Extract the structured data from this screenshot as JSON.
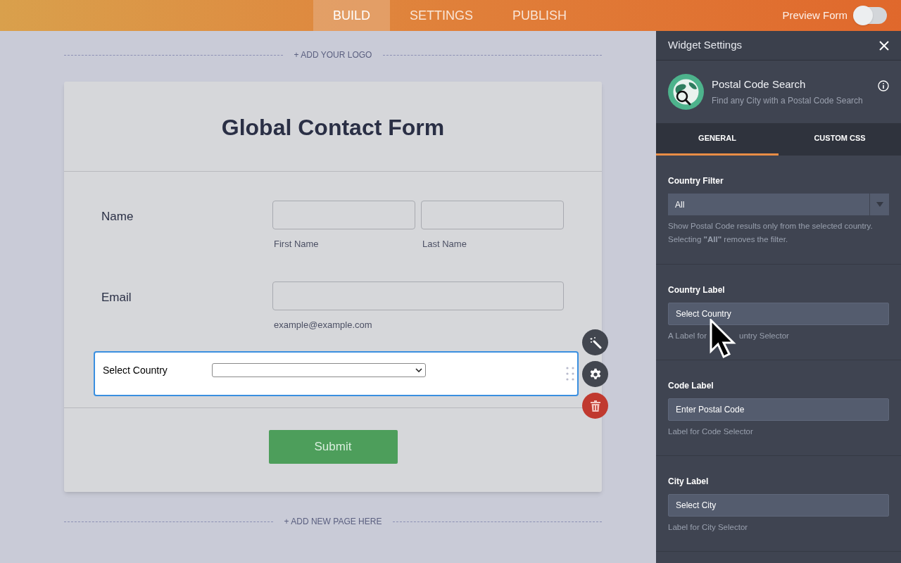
{
  "top_bar": {
    "tabs": [
      {
        "label": "BUILD",
        "selected": true
      },
      {
        "label": "SETTINGS",
        "selected": false
      },
      {
        "label": "PUBLISH",
        "selected": false
      }
    ],
    "preview": {
      "label": "Preview Form",
      "on": false
    }
  },
  "canvas": {
    "add_logo": "+ ADD YOUR LOGO",
    "add_page": "+ ADD NEW PAGE HERE"
  },
  "form": {
    "title": "Global Contact Form",
    "fields": [
      {
        "kind": "name",
        "label": "Name",
        "sublabels": [
          "First Name",
          "Last Name"
        ]
      },
      {
        "kind": "email",
        "label": "Email",
        "sublabels": [
          "example@example.com"
        ]
      },
      {
        "kind": "select",
        "label": "Select Country",
        "selected": true
      }
    ],
    "submit": "Submit"
  },
  "widget_settings": {
    "title": "Widget Settings",
    "widget_name": "Postal Code Search",
    "widget_description": "Find any City with a Postal Code Search",
    "tabs": [
      {
        "label": "GENERAL",
        "selected": true
      },
      {
        "label": "CUSTOM CSS",
        "selected": false
      }
    ],
    "settings": [
      {
        "kind": "dropdown",
        "label": "Country Filter",
        "value": "All",
        "hint": "Show Postal Code results only from the selected country. Selecting **\"All\"** removes the filter."
      },
      {
        "kind": "text",
        "label": "Country Label",
        "value": "Select Country",
        "hint_parts": [
          "A Label for",
          "untry Selector"
        ]
      },
      {
        "kind": "text",
        "label": "Code Label",
        "value": "Enter Postal Code",
        "hint": "Label for Code Selector"
      },
      {
        "kind": "text",
        "label": "City Label",
        "value": "Select City",
        "hint": "Label for City Selector"
      }
    ]
  }
}
